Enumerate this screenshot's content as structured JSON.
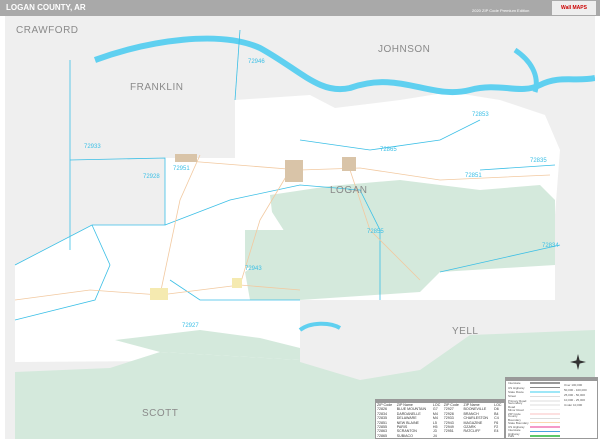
{
  "header": {
    "title": "LOGAN COUNTY, AR",
    "edition": "2020 ZIP Code Premium Edition",
    "logo": "Wall MAPS"
  },
  "colors": {
    "forest": "#d4e9dc",
    "county": "#ffffff",
    "outside": "#efefef",
    "water": "#5fd0f0",
    "zip_boundary": "#3bbfe6",
    "town": "#d9c4a8",
    "header": "#a9a9a9"
  },
  "map": {
    "county_labels": [
      "CRAWFORD",
      "JOHNSON",
      "FRANKLIN",
      "LOGAN",
      "YELL",
      "SCOTT"
    ],
    "zip_labels": [
      "72946",
      "72853",
      "72933",
      "72865",
      "72835",
      "72928",
      "72951",
      "72851",
      "72855",
      "72834",
      "72943",
      "72927"
    ]
  },
  "zip_table": {
    "headers": [
      "ZIP Code",
      "ZIP Name",
      "LOC",
      "ZIP Code",
      "ZIP Name",
      "LOC"
    ],
    "rows": [
      [
        "72826",
        "BLUE MOUNTAIN",
        "G7",
        "72927",
        "BOONEVILLE",
        "D6"
      ],
      [
        "72834",
        "DARDANELLE",
        "M4",
        "72928",
        "BRANCH",
        "B4"
      ],
      [
        "72835",
        "DELAWARE",
        "M4",
        "72933",
        "CHARLESTON",
        "C4"
      ],
      [
        "72851",
        "NEW BLAINE",
        "L5",
        "72943",
        "MAGAZINE",
        "F6"
      ],
      [
        "72855",
        "PARIS",
        "H5",
        "72949",
        "OZARK",
        "F2"
      ],
      [
        "72863",
        "SCRANTON",
        "J3",
        "72951",
        "RATCLIFF",
        "E4"
      ],
      [
        "72865",
        "SUBIACO",
        "J4",
        "",
        "",
        ""
      ]
    ]
  },
  "legend": {
    "items": [
      "Interstate",
      "US Highway",
      "State Route",
      "Street",
      "Primary Road",
      "Secondary Road",
      "Minor Road",
      "ZIP Code",
      "County Boundary",
      "State Boundary",
      "US Highway",
      "Interstate Highway",
      "Park"
    ],
    "city_sizes": [
      "Over 100,000",
      "50,000 - 100,000",
      "25,000 - 50,000",
      "10,000 - 25,000",
      "Under 10,000"
    ]
  },
  "compass": {
    "label": "N"
  }
}
